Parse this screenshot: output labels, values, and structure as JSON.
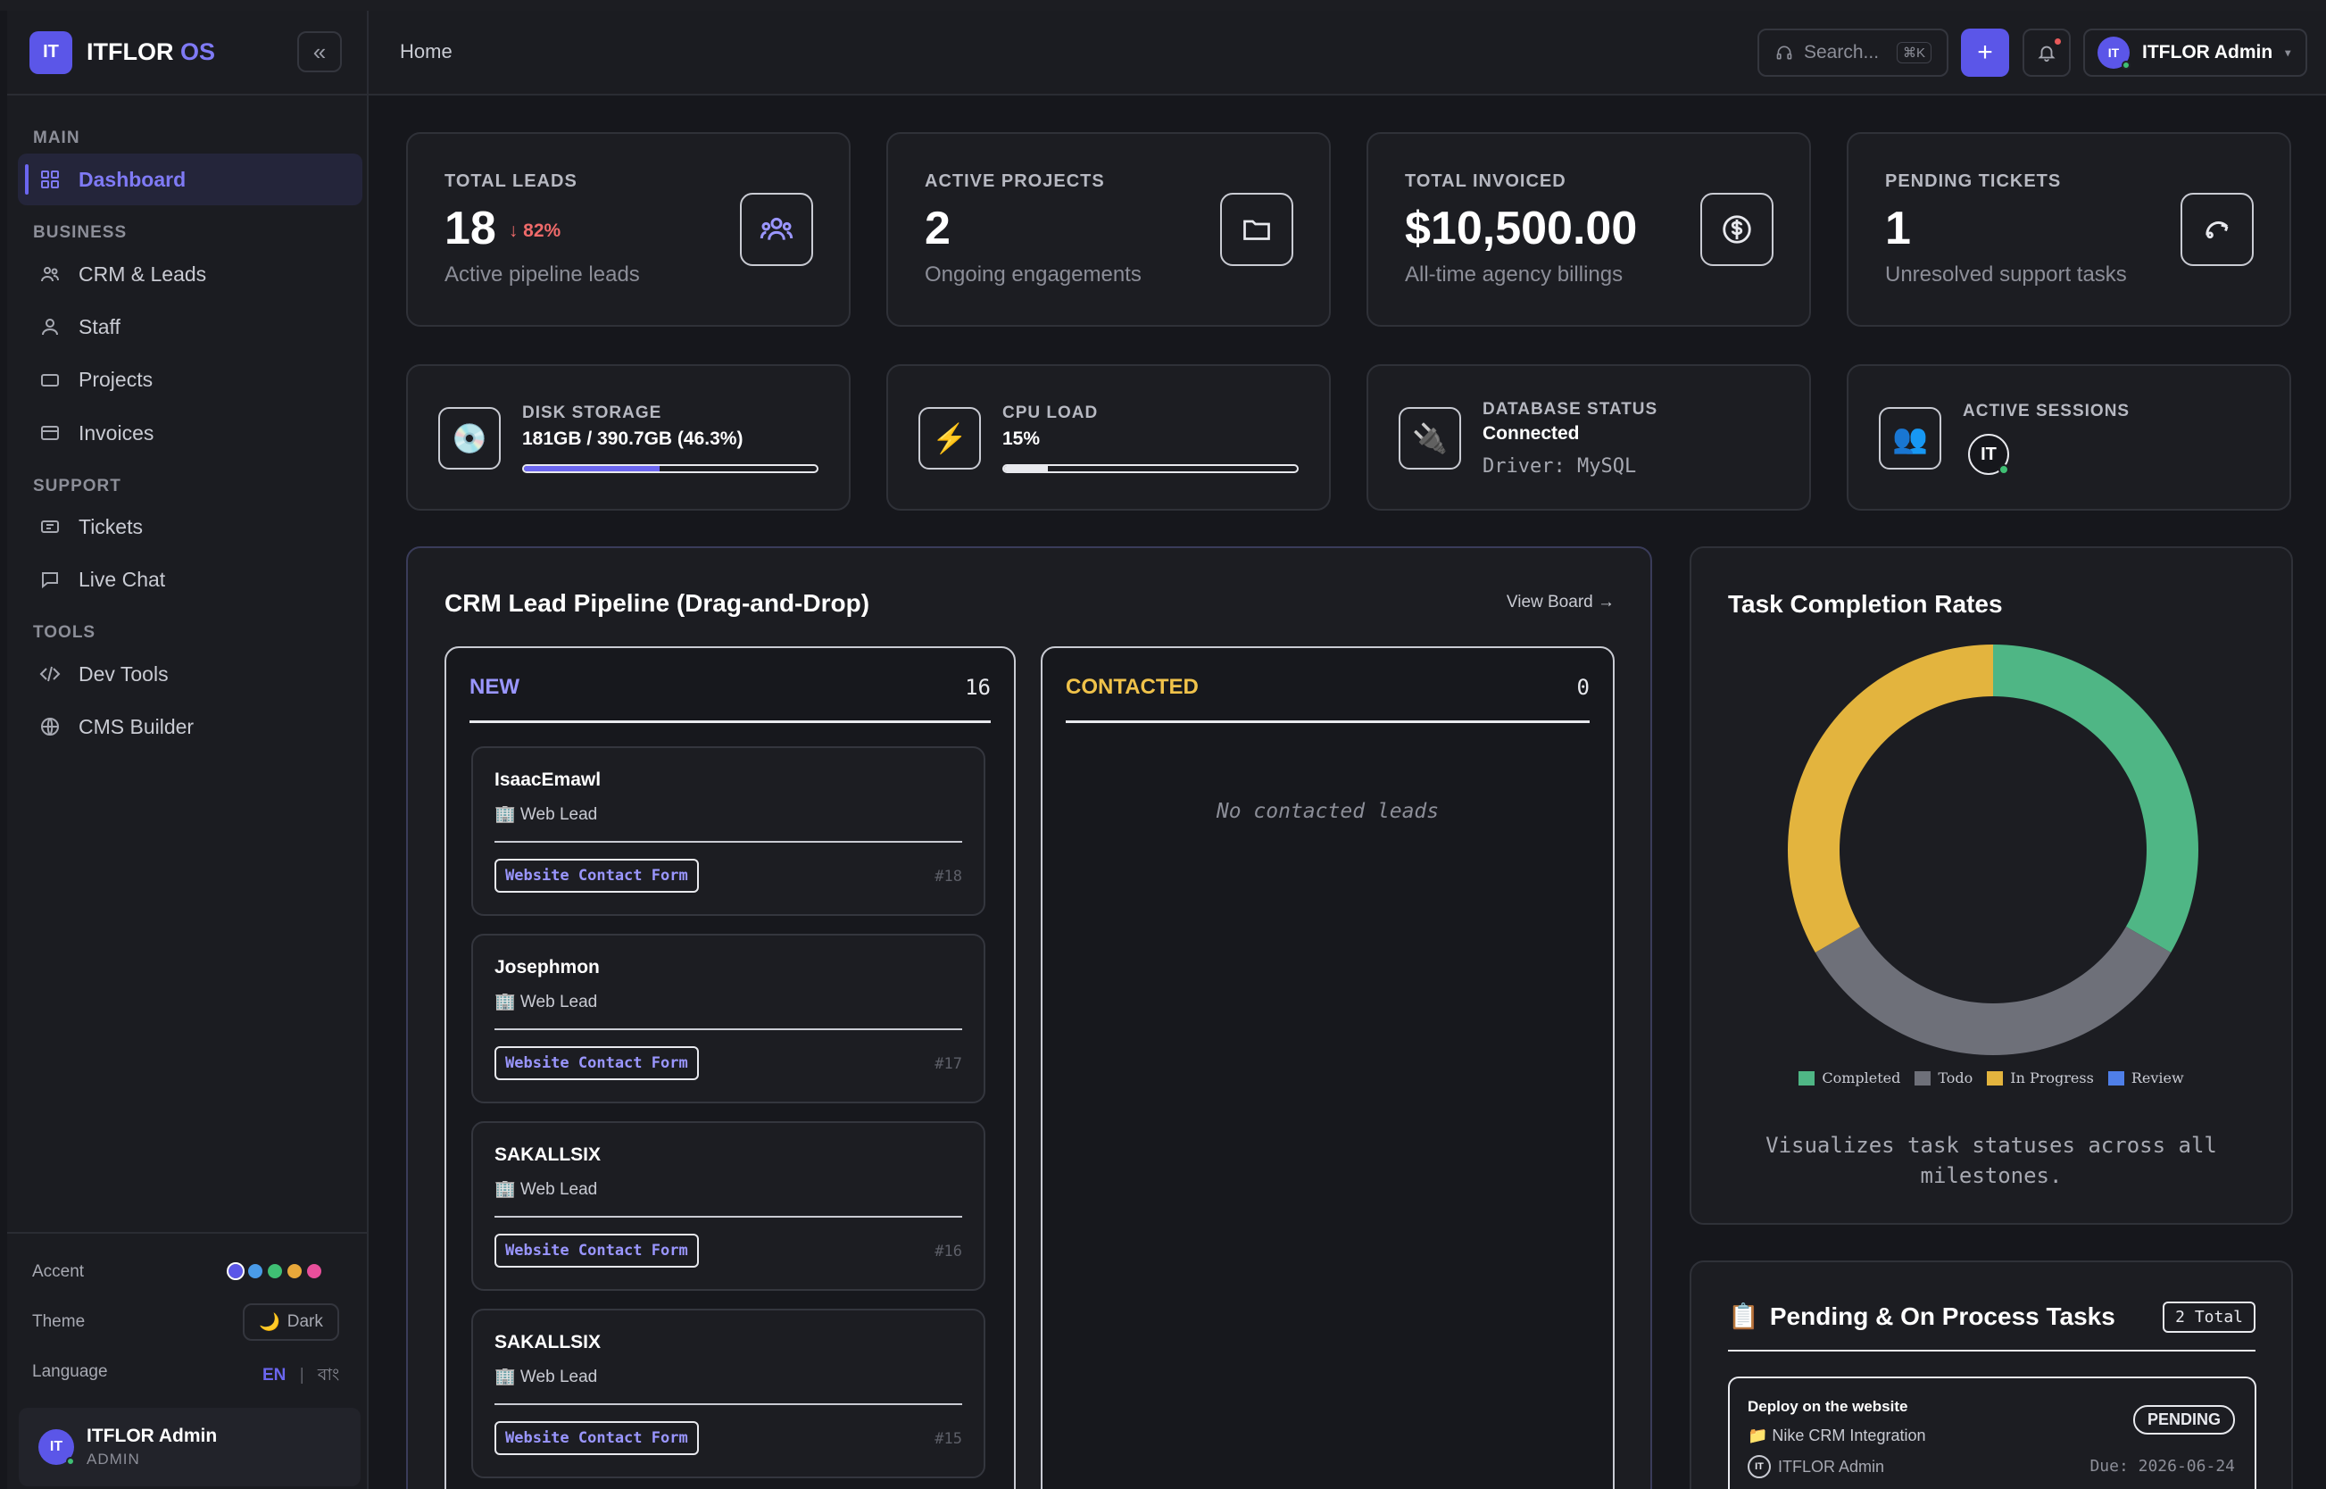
{
  "app": {
    "logo_initials": "IT",
    "brand_main": "ITFLOR",
    "brand_accent": "OS",
    "accent_color": "#5b56e8"
  },
  "sidebar": {
    "sections": {
      "main": "MAIN",
      "business": "BUSINESS",
      "support": "SUPPORT",
      "tools": "TOOLS"
    },
    "items": [
      {
        "label": "Dashboard",
        "icon": "grid-icon",
        "active": true
      },
      {
        "label": "CRM & Leads",
        "icon": "users-icon"
      },
      {
        "label": "Staff",
        "icon": "person-icon"
      },
      {
        "label": "Projects",
        "icon": "folder-icon"
      },
      {
        "label": "Invoices",
        "icon": "card-icon"
      },
      {
        "label": "Tickets",
        "icon": "ticket-icon"
      },
      {
        "label": "Live Chat",
        "icon": "chat-icon"
      },
      {
        "label": "Dev Tools",
        "icon": "code-icon"
      },
      {
        "label": "CMS Builder",
        "icon": "globe-icon"
      }
    ],
    "accent_label": "Accent",
    "accent_colors": [
      "#5b56e8",
      "#4a9be8",
      "#3fbf74",
      "#e8a83a",
      "#e84f9b"
    ],
    "theme_label": "Theme",
    "theme_value": "Dark",
    "language_label": "Language",
    "lang_en": "EN",
    "lang_sep": "|",
    "lang_bn": "বাং",
    "user": {
      "initials": "IT",
      "name": "ITFLOR Admin",
      "role": "ADMIN"
    }
  },
  "header": {
    "breadcrumb": "Home",
    "search_placeholder": "Search...",
    "search_shortcut": "⌘K",
    "add_label": "+",
    "user_initials": "IT",
    "user_name": "ITFLOR Admin"
  },
  "kpis": [
    {
      "label": "TOTAL LEADS",
      "value": "18",
      "delta": "↓ 82%",
      "sub": "Active pipeline leads",
      "icon": "users-icon"
    },
    {
      "label": "ACTIVE PROJECTS",
      "value": "2",
      "sub": "Ongoing engagements",
      "icon": "folder-icon"
    },
    {
      "label": "TOTAL INVOICED",
      "value": "$10,500.00",
      "sub": "All-time agency billings",
      "icon": "dollar-icon"
    },
    {
      "label": "PENDING TICKETS",
      "value": "1",
      "sub": "Unresolved support tasks",
      "icon": "headset-icon"
    }
  ],
  "system": {
    "disk": {
      "label": "DISK STORAGE",
      "value": "181GB / 390.7GB (46.3%)",
      "percent": 46.3,
      "icon": "💿"
    },
    "cpu": {
      "label": "CPU LOAD",
      "value": "15%",
      "percent": 15,
      "icon": "⚡"
    },
    "db": {
      "label": "DATABASE STATUS",
      "value": "Connected",
      "driver": "Driver: MySQL",
      "icon": "🔌"
    },
    "sessions": {
      "label": "ACTIVE SESSIONS",
      "icon": "👥",
      "session_initials": "IT"
    }
  },
  "pipeline": {
    "title": "CRM Lead Pipeline (Drag-and-Drop)",
    "view_board": "View Board →",
    "columns": [
      {
        "name": "NEW",
        "count": "16",
        "color": "#9a96ff"
      },
      {
        "name": "CONTACTED",
        "count": "0",
        "color": "#f0c24a",
        "empty": "No contacted leads"
      }
    ],
    "leads": [
      {
        "name": "IsaacEmawl",
        "type": "🏢 Web Lead",
        "source": "Website Contact Form",
        "id": "#18"
      },
      {
        "name": "Josephmon",
        "type": "🏢 Web Lead",
        "source": "Website Contact Form",
        "id": "#17"
      },
      {
        "name": "SAKALLSIX",
        "type": "🏢 Web Lead",
        "source": "Website Contact Form",
        "id": "#16"
      },
      {
        "name": "SAKALLSIX",
        "type": "🏢 Web Lead",
        "source": "Website Contact Form",
        "id": "#15"
      }
    ]
  },
  "chart_data": {
    "type": "pie",
    "title": "Task Completion Rates",
    "categories": [
      "Completed",
      "Todo",
      "In Progress",
      "Review"
    ],
    "values": [
      1,
      1,
      1,
      0
    ],
    "colors": [
      "#4fb685",
      "#6e7079",
      "#e3b43e",
      "#4f7fe8"
    ],
    "legend": "bottom",
    "caption": "Visualizes task statuses across all milestones."
  },
  "tasks": {
    "icon": "📋",
    "title": "Pending & On Process Tasks",
    "total": "2 Total",
    "items": [
      {
        "title": "Deploy on the website",
        "project": "📁 Nike CRM Integration",
        "assignee": "ITFLOR Admin",
        "status": "PENDING",
        "due": "Due: 2026-06-24"
      }
    ]
  }
}
